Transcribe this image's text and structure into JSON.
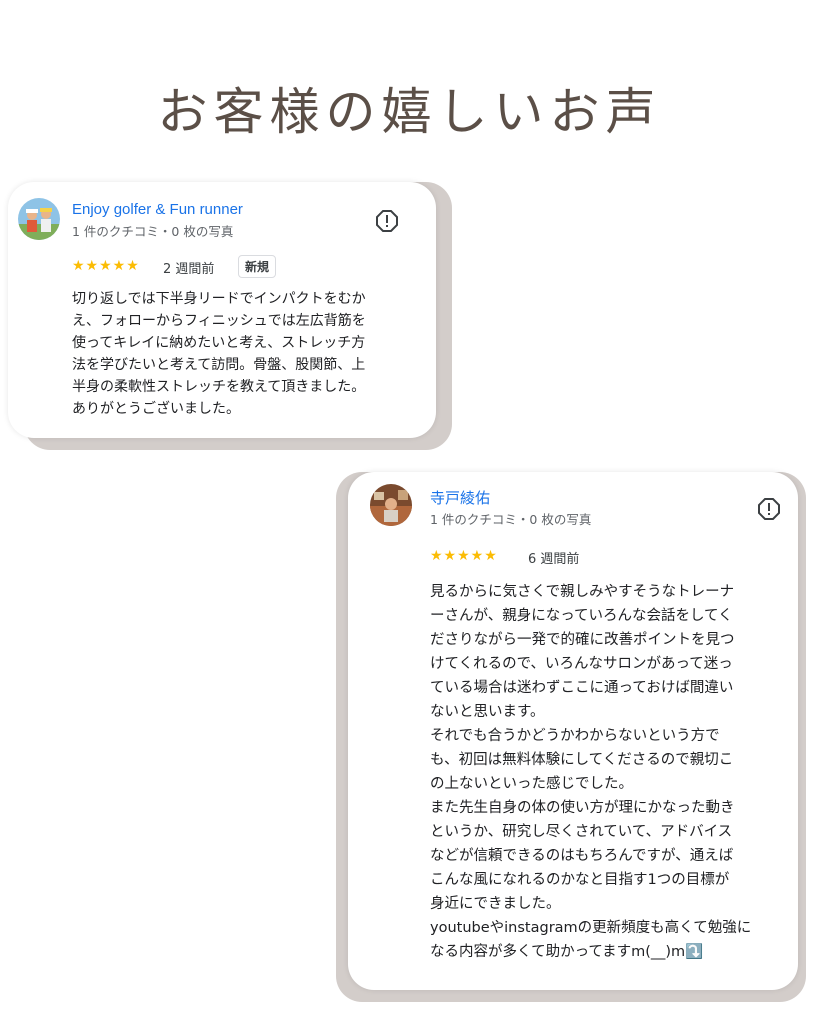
{
  "page": {
    "title": "お客様の嬉しいお声"
  },
  "colors": {
    "title": "#5b4f47",
    "name_link": "#1a73e8",
    "stars": "#fbbc04",
    "card_shadow": "#d3cdca"
  },
  "reviews": [
    {
      "name": "Enjoy golfer & Fun runner",
      "meta": "1 件のクチコミ・0 枚の写真",
      "stars": "★★★★★",
      "rating": 5,
      "date": "2 週間前",
      "badge": "新規",
      "text": "切り返しでは下半身リードでインパクトをむか\nえ、フォローからフィニッシュでは左広背筋を\n使ってキレイに納めたいと考え、ストレッチ方\n法を学びたいと考えて訪問。骨盤、股関節、上\n半身の柔軟性ストレッチを教えて頂きました。\nありがとうございました。",
      "avatar_icon": "avatar-golfers",
      "flag_icon": "report-flag-icon"
    },
    {
      "name": "寺戸綾佑",
      "meta": "1 件のクチコミ・0 枚の写真",
      "stars": "★★★★★",
      "rating": 5,
      "date": "6 週間前",
      "text": "見るからに気さくで親しみやすそうなトレーナ\nーさんが、親身になっていろんな会話をしてく\nださりながら一発で的確に改善ポイントを見つ\nけてくれるので、いろんなサロンがあって迷っ\nている場合は迷わずここに通っておけば間違い\nないと思います。\nそれでも合うかどうかわからないという方で\nも、初回は無料体験にしてくださるので親切こ\nの上ないといった感じでした。\nまた先生自身の体の使い方が理にかなった動き\nというか、研究し尽くされていて、アドバイス\nなどが信頼できるのはもちろんですが、通えば\nこんな風になれるのかなと目指す1つの目標が\n身近にできました。\nyoutubeやinstagramの更新頻度も高くて勉強に\nなる内容が多くて助かってますm(__)m⤵️",
      "avatar_icon": "avatar-person",
      "flag_icon": "report-flag-icon"
    }
  ]
}
